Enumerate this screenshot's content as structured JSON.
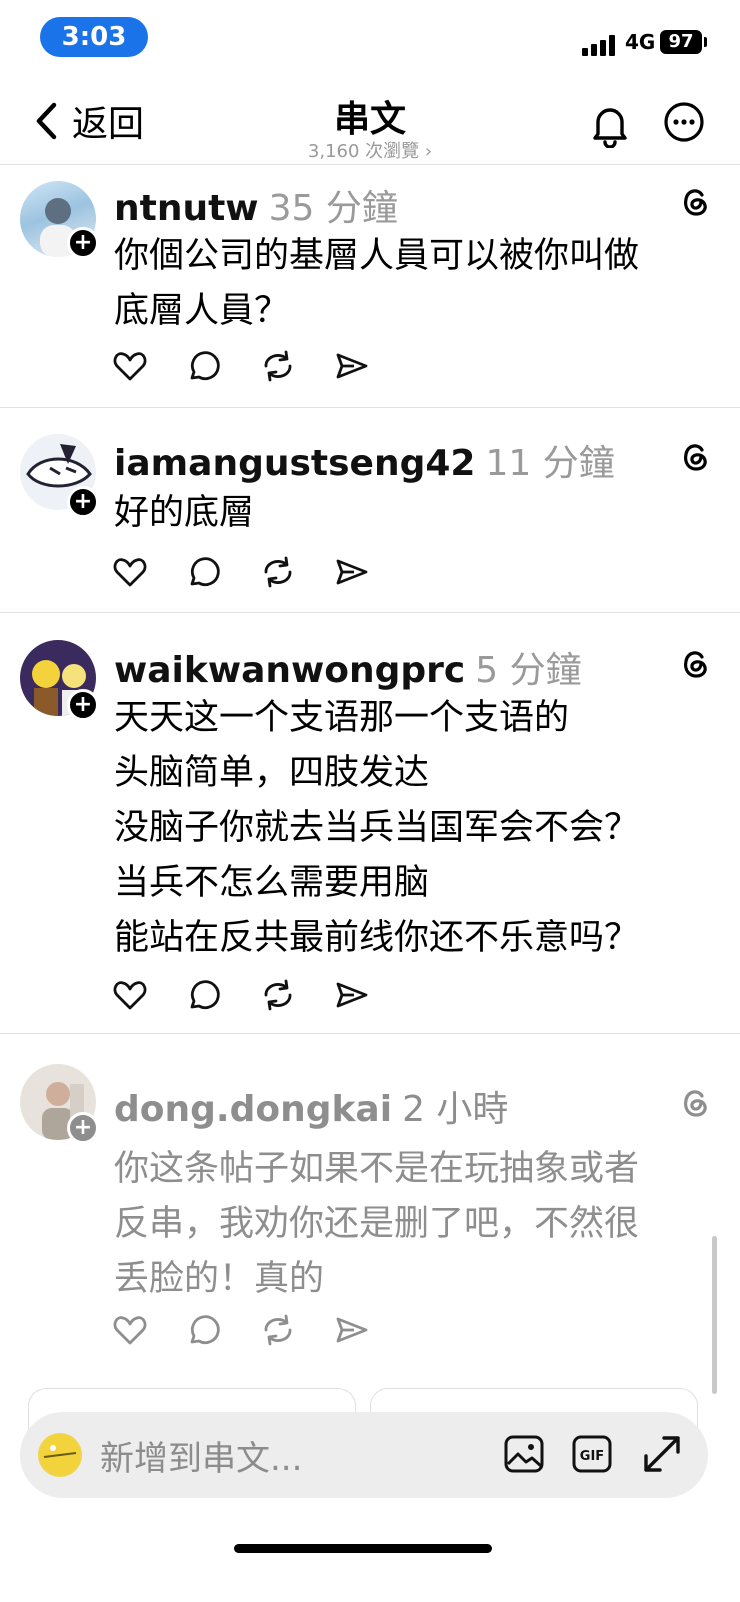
{
  "status_bar": {
    "time": "3:03",
    "network": "4G",
    "battery": "97"
  },
  "nav": {
    "back_label": "返回",
    "title": "串文",
    "views": "3,160 次瀏覽 ›"
  },
  "posts": [
    {
      "username": "ntnutw",
      "time": "35 分鐘",
      "text": "你個公司的基層人員可以被你叫做\n底層人員？"
    },
    {
      "username": "iamangustseng42",
      "time": "11 分鐘",
      "text": "好的底層"
    },
    {
      "username": "waikwanwongprc",
      "time": "5 分鐘",
      "text": "天天这一个支语那一个支语的\n头脑简单，四肢发达\n没脑子你就去当兵当国军会不会？\n当兵不怎么需要用脑\n能站在反共最前线你还不乐意吗？"
    },
    {
      "username": "dong.dongkai",
      "time": "2 小時",
      "text": "你这条帖子如果不是在玩抽象或者\n反串，我劝你还是删了吧，不然很\n丢脸的！真的"
    }
  ],
  "composer": {
    "placeholder": "新增到串文..."
  },
  "icons": {
    "back": "chevron-left-icon",
    "notify": "bell-icon",
    "more": "more-icon",
    "like": "heart-icon",
    "reply": "comment-icon",
    "repost": "repost-icon",
    "share": "send-icon",
    "threads": "threads-logo-icon",
    "image": "image-icon",
    "gif": "gif-icon",
    "expand": "expand-icon"
  },
  "colors": {
    "time_pill": "#1a73e8",
    "faded_text": "#8e8e8e",
    "meta": "#9a9a9a"
  }
}
